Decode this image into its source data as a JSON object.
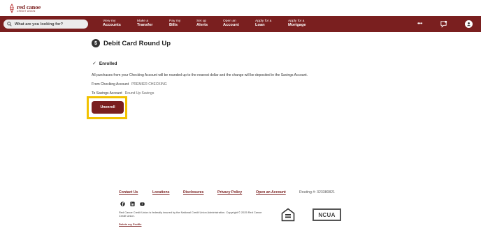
{
  "brand": {
    "name": "red canoe",
    "subtitle": "CREDIT UNION",
    "color": "#7a1f1f"
  },
  "search": {
    "placeholder": "What are you looking for?"
  },
  "nav": [
    {
      "line1": "View my",
      "line2": "Accounts"
    },
    {
      "line1": "Make a",
      "line2": "Transfer"
    },
    {
      "line1": "Pay my",
      "line2": "Bills"
    },
    {
      "line1": "Set up",
      "line2": "Alerts"
    },
    {
      "line1": "Open an",
      "line2": "Account"
    },
    {
      "line1": "Apply for a",
      "line2": "Loan"
    },
    {
      "line1": "Apply for a",
      "line2": "Mortgage"
    }
  ],
  "nav_more": "•••",
  "page": {
    "title_icon": "$",
    "title": "Debit Card Round Up",
    "status": "Enrolled",
    "description": "All purchases from your Checking Account will be rounded up to the nearest dollar and the change will be deposited in the Savings Account.",
    "from_label": "From Checking Account",
    "from_value": "PREMIER CHECKING",
    "to_label": "To Savings Account",
    "to_value": "Round Up Savings",
    "unenroll_label": "Unenroll",
    "highlight_color": "#f2c200"
  },
  "footer": {
    "links": [
      "Contact Us",
      "Locations",
      "Disclosures",
      "Privacy Policy",
      "Open an Account"
    ],
    "routing": "Routing #: 323380821",
    "social_icons": [
      "facebook-icon",
      "linkedin-icon",
      "youtube-icon"
    ],
    "legal": "Red Canoe Credit Union is federally insured by the National Credit Union Administration. Copyright © 2025 Red Canoe Credit Union.",
    "delete_profile": "Delete my Profile",
    "ncua": "NCUA"
  }
}
